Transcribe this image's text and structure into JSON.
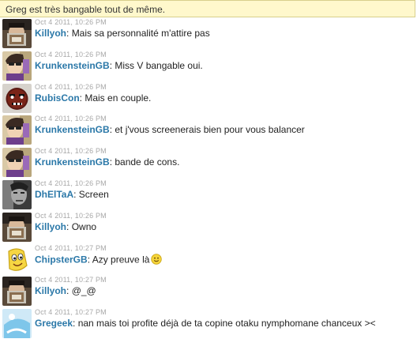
{
  "header": {
    "notice": "Greg est très bangable tout de même."
  },
  "messages": [
    {
      "user": "Killyoh",
      "time": "Oct 4 2011, 10:26 PM",
      "text": "Mais sa personnalité m'attire pas",
      "avatar": "killyoh-avatar"
    },
    {
      "user": "KrunkensteinGB",
      "time": "Oct 4 2011, 10:26 PM",
      "text": "Miss V bangable oui.",
      "avatar": "krunkenstein-avatar"
    },
    {
      "user": "RubisCon",
      "time": "Oct 4 2011, 10:26 PM",
      "text": "Mais en couple.",
      "avatar": "rubiscon-avatar"
    },
    {
      "user": "KrunkensteinGB",
      "time": "Oct 4 2011, 10:26 PM",
      "text": "et j'vous screenerais bien pour vous balancer",
      "avatar": "krunkenstein-avatar"
    },
    {
      "user": "KrunkensteinGB",
      "time": "Oct 4 2011, 10:26 PM",
      "text": "bande de cons.",
      "avatar": "krunkenstein-avatar"
    },
    {
      "user": "DhElTaA",
      "time": "Oct 4 2011, 10:26 PM",
      "text": "Screen",
      "avatar": "dheltaa-avatar"
    },
    {
      "user": "Killyoh",
      "time": "Oct 4 2011, 10:26 PM",
      "text": "Owno",
      "avatar": "killyoh-avatar"
    },
    {
      "user": "ChipsterGB",
      "time": "Oct 4 2011, 10:27 PM",
      "text": "Azy preuve là",
      "avatar": "chipster-avatar",
      "emoji": "smiley-icon"
    },
    {
      "user": "Killyoh",
      "time": "Oct 4 2011, 10:27 PM",
      "text": "@_@",
      "avatar": "killyoh-avatar"
    },
    {
      "user": "Gregeek",
      "time": "Oct 4 2011, 10:27 PM",
      "text": "nan mais toi profite déjà de ta copine otaku nymphomane chanceux ><",
      "avatar": "gregeek-avatar"
    }
  ],
  "colors": {
    "username": "#2b78a8",
    "timestamp": "#a8a8a8",
    "notice_bg": "#fff8cc"
  }
}
